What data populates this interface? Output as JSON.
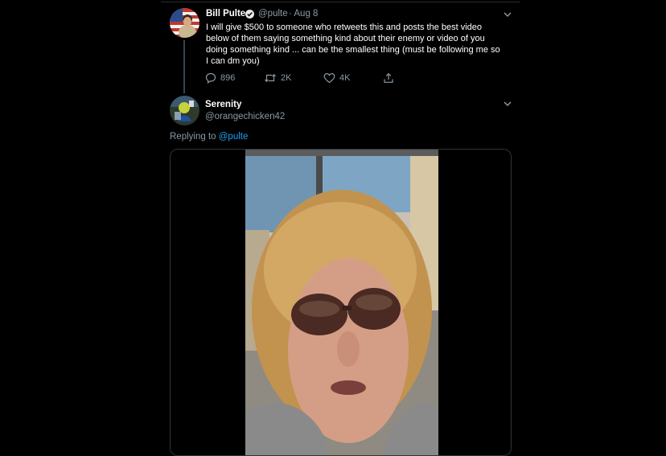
{
  "tweet": {
    "name": "Bill Pulte",
    "handle": "@pulte",
    "date": "· Aug 8",
    "text": "I will give $500 to someone who retweets this and posts the best video\nbelow of them saying something kind about their enemy or video of you\ndoing something kind ... can be the smallest thing (must be following me so\nI can dm you)",
    "actions": {
      "replies": "896",
      "retweets": "2K",
      "likes": "4K"
    }
  },
  "reply": {
    "name": "Serenity",
    "handle": "@orangechicken42",
    "replying_prefix": "Replying to",
    "replying_to": "@pulte"
  },
  "colors": {
    "background": "#000000",
    "secondary_text": "#8899a6",
    "link": "#1da1f2",
    "primary_text": "#ffffff"
  },
  "icons": [
    "verified-badge-icon",
    "chevron-down-icon",
    "reply-icon",
    "retweet-icon",
    "like-icon",
    "share-icon"
  ]
}
